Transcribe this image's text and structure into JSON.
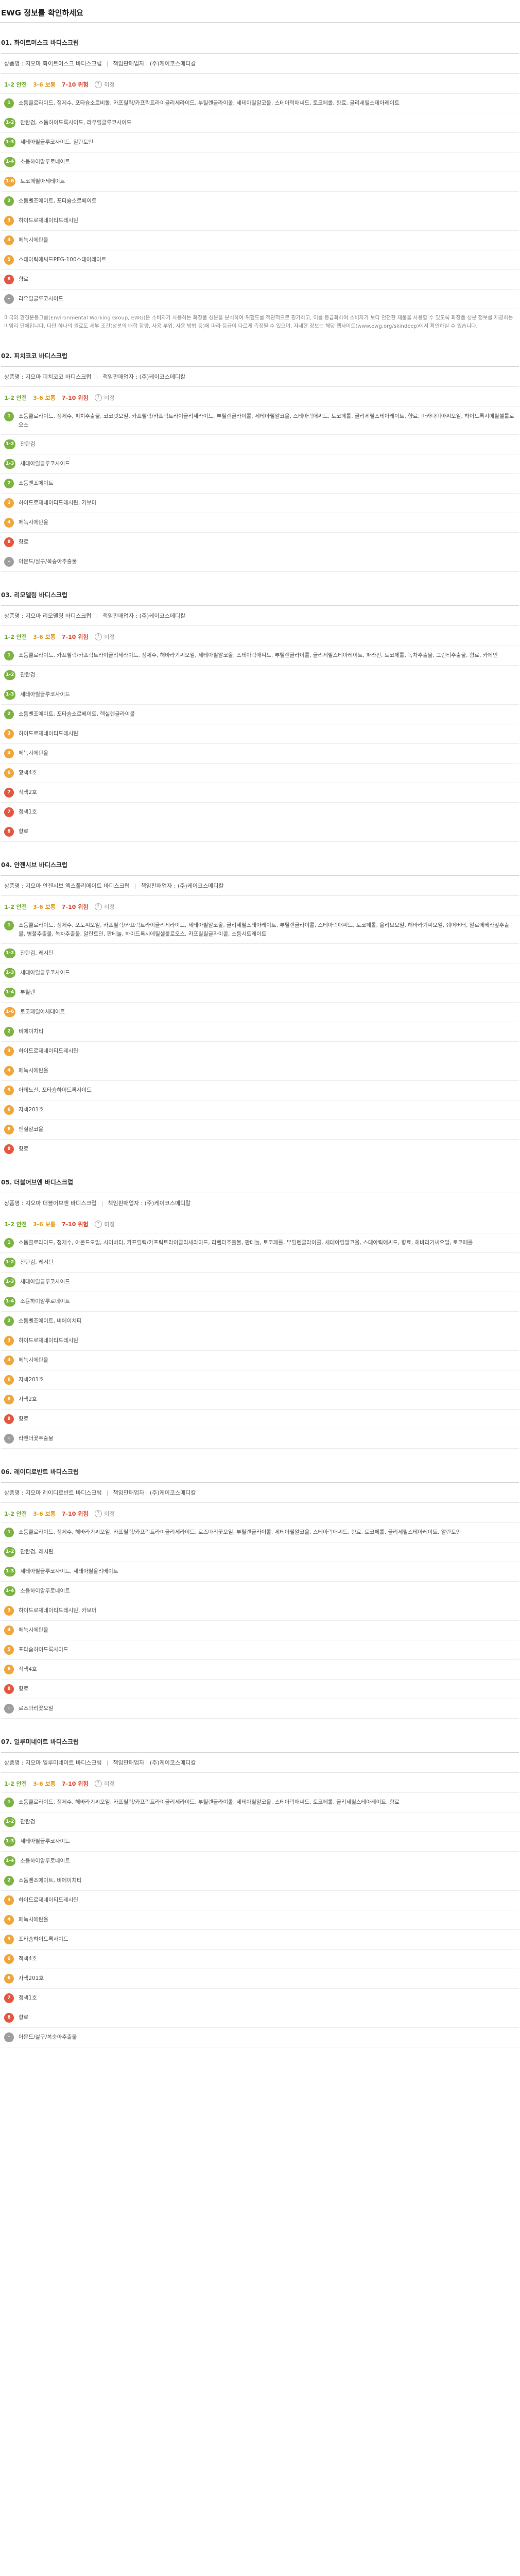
{
  "page": {
    "title": "EWG 정보를 확인하세요"
  },
  "legend": {
    "low": "1-2 안전",
    "mid": "3-6 보통",
    "high": "7-10 위험",
    "na": "미정"
  },
  "labels": {
    "product_prefix": "상품명 : ",
    "maker_prefix": "책임판매업자 : "
  },
  "notice": "미국의 환경운동그룹(Environmental Working Group, EWG)은 소비자가 사용하는 화장품 성분을 분석하여 위험도를 객관적으로 평가하고, 이를 등급화하여 소비자가 보다 안전한 제품을 사용할 수 있도록 화장품 성분 정보를 제공하는 비영리 단체입니다. 다만 하나의 원료도 세부 조건(성분의 배합 함량, 사용 부위, 사용 방법 등)에 따라 등급이 다르게 측정될 수 있으며, 자세한 정보는 해당 웹사이트(www.ewg.org/skindeep)에서 확인하실 수 있습니다.",
  "products": [
    {
      "section_title": "01. 화이트머스크 바디스크럽",
      "product_name": "지오마 화이트머스크 바디스크럽",
      "maker": "(주)케이코스메디칼",
      "ingredients": [
        {
          "grade": "1",
          "level": "low",
          "names": "소듐클로라이드, 정제수, 포타슘소르비톨, 카프릴릭/카프릭트라이글리세라이드, 부틸렌글라이콜, 세테아릴알코올, 스테아릭애씨드, 토코페롤, 향료, 글리세릴스테아레이트"
        },
        {
          "grade": "1-2",
          "level": "low",
          "names": "잔탄검, 소듐하이드록사이드, 라우릴글루코사이드"
        },
        {
          "grade": "1-3",
          "level": "low",
          "names": "세테아릴글루코사이드, 알란토인"
        },
        {
          "grade": "1-4",
          "level": "low",
          "names": "소듐하이알루로네이트"
        },
        {
          "grade": "1-6",
          "level": "mid",
          "names": "토코페릴아세테이트"
        },
        {
          "grade": "2",
          "level": "low",
          "names": "소듐벤조에이트, 포타슘소르베이트"
        },
        {
          "grade": "3",
          "level": "mid",
          "names": "하이드로제네이티드레시틴"
        },
        {
          "grade": "4",
          "level": "mid",
          "names": "페녹시에탄올"
        },
        {
          "grade": "5",
          "level": "mid",
          "names": "스테아릭애씨드PEG-100스테아레이트"
        },
        {
          "grade": "8",
          "level": "high",
          "names": "향료"
        },
        {
          "grade": "-",
          "level": "na",
          "names": "라우릴글루코사이드"
        }
      ]
    },
    {
      "section_title": "02. 피치코코 바디스크럽",
      "product_name": "지오마 피치코코 바디스크럽",
      "maker": "(주)케이코스메디칼",
      "ingredients": [
        {
          "grade": "1",
          "level": "low",
          "names": "소듐클로라이드, 정제수, 피치추출물, 코코넛오일, 카프릴릭/카프릭트라이글리세라이드, 부틸렌글라이콜, 세테아릴알코올, 스테아릭애씨드, 토코페롤, 글리세릴스테아레이트, 향료, 마카다미아씨오일, 하이드록시에틸셀룰로오스"
        },
        {
          "grade": "1-2",
          "level": "low",
          "names": "잔탄검"
        },
        {
          "grade": "1-3",
          "level": "low",
          "names": "세테아릴글루코사이드"
        },
        {
          "grade": "2",
          "level": "low",
          "names": "소듐벤조에이트"
        },
        {
          "grade": "3",
          "level": "mid",
          "names": "하이드로제네이티드레시틴, 카보머"
        },
        {
          "grade": "4",
          "level": "mid",
          "names": "페녹시에탄올"
        },
        {
          "grade": "8",
          "level": "high",
          "names": "향료"
        },
        {
          "grade": "-",
          "level": "na",
          "names": "아몬드/살구/복숭아추출물"
        }
      ]
    },
    {
      "section_title": "03. 리모델링 바디스크럽",
      "product_name": "지오마 리모델링 바디스크럽",
      "maker": "(주)케이코스메디칼",
      "ingredients": [
        {
          "grade": "1",
          "level": "low",
          "names": "소듐클로라이드, 카프릴릭/카프릭트라이글리세라이드, 정제수, 해바라기씨오일, 세테아릴알코올, 스테아릭애씨드, 부틸렌글라이콜, 글리세릴스테아레이트, 파라핀, 토코페롤, 녹차추출물, 그린티추출물, 향료, 카페인"
        },
        {
          "grade": "1-2",
          "level": "low",
          "names": "잔탄검"
        },
        {
          "grade": "1-3",
          "level": "low",
          "names": "세테아릴글루코사이드"
        },
        {
          "grade": "2",
          "level": "low",
          "names": "소듐벤조에이트, 포타슘소르베이트, 헥실렌글라이콜"
        },
        {
          "grade": "3",
          "level": "mid",
          "names": "하이드로제네이티드레시틴"
        },
        {
          "grade": "4",
          "level": "mid",
          "names": "페녹시에탄올"
        },
        {
          "grade": "6",
          "level": "mid",
          "names": "황색4호"
        },
        {
          "grade": "7",
          "level": "high",
          "names": "적색2호"
        },
        {
          "grade": "7",
          "level": "high",
          "names": "청색1호"
        },
        {
          "grade": "8",
          "level": "high",
          "names": "향료"
        }
      ]
    },
    {
      "section_title": "04. 안젠시브 바디스크럽",
      "product_name": "지오마 안젠시브 엑스폴리에이트 바디스크럽",
      "maker": "(주)케이코스메디칼",
      "ingredients": [
        {
          "grade": "1",
          "level": "low",
          "names": "소듐클로라이드, 정제수, 포도씨오일, 카프릴릭/카프릭트라이글리세라이드, 세테아릴알코올, 글리세릴스테아레이트, 부틸렌글라이콜, 스테아릭애씨드, 토코페롤, 올리브오일, 해바라기씨오일, 쉐어버터, 알로에베라잎추출물, 병풀추출물, 녹차추출물, 알란토인, 판테놀, 하이드록시에틸셀룰로오스, 카프릴릴글라이콜, 소듐시트레이트"
        },
        {
          "grade": "1-2",
          "level": "low",
          "names": "잔탄검, 레시틴"
        },
        {
          "grade": "1-3",
          "level": "low",
          "names": "세테아릴글루코사이드"
        },
        {
          "grade": "1-4",
          "level": "low",
          "names": "부틸렌"
        },
        {
          "grade": "1-6",
          "level": "mid",
          "names": "토코페릴아세테이트"
        },
        {
          "grade": "2",
          "level": "low",
          "names": "비에이치티"
        },
        {
          "grade": "3",
          "level": "mid",
          "names": "하이드로제네이티드레시틴"
        },
        {
          "grade": "4",
          "level": "mid",
          "names": "페녹시에탄올"
        },
        {
          "grade": "5",
          "level": "mid",
          "names": "아데노신, 포타슘하이드록사이드"
        },
        {
          "grade": "6",
          "level": "mid",
          "names": "자색201호"
        },
        {
          "grade": "6",
          "level": "mid",
          "names": "벤질알코올"
        },
        {
          "grade": "8",
          "level": "high",
          "names": "향료"
        }
      ]
    },
    {
      "section_title": "05. 더블어브앤 바디스크럽",
      "product_name": "지오마 더블어브앤 바디스크럽",
      "maker": "(주)케이코스메디칼",
      "ingredients": [
        {
          "grade": "1",
          "level": "low",
          "names": "소듐클로라이드, 정제수, 아몬드오일, 시어버터, 카프릴릭/카프릭트라이글리세라이드, 라벤더추출물, 판테놀, 토코페롤, 부틸렌글라이콜, 세테아릴알코올, 스테아릭애씨드, 향료, 해바라기씨오일, 토코페롤"
        },
        {
          "grade": "1-2",
          "level": "low",
          "names": "잔탄검, 레시틴"
        },
        {
          "grade": "1-3",
          "level": "low",
          "names": "세테아릴글루코사이드"
        },
        {
          "grade": "1-4",
          "level": "low",
          "names": "소듐하이알루로네이트"
        },
        {
          "grade": "2",
          "level": "low",
          "names": "소듐벤조에이트, 비에이치티"
        },
        {
          "grade": "3",
          "level": "mid",
          "names": "하이드로제네이티드레시틴"
        },
        {
          "grade": "4",
          "level": "mid",
          "names": "페녹시에탄올"
        },
        {
          "grade": "6",
          "level": "mid",
          "names": "자색201호"
        },
        {
          "grade": "6",
          "level": "mid",
          "names": "자색2호"
        },
        {
          "grade": "8",
          "level": "high",
          "names": "향료"
        },
        {
          "grade": "-",
          "level": "na",
          "names": "라벤더꽃추출물"
        }
      ]
    },
    {
      "section_title": "06. 레이디로반트 바디스크럽",
      "product_name": "지오마 레이디로반트 바디스크럽",
      "maker": "(주)케이코스메디칼",
      "ingredients": [
        {
          "grade": "1",
          "level": "low",
          "names": "소듐클로라이드, 정제수, 해바라기씨오일, 카프릴릭/카프릭트라이글리세라이드, 로즈마리꽃오일, 부틸렌글라이콜, 세테아릴알코올, 스테아릭애씨드, 향료, 토코페롤, 글리세릴스테아레이트, 알란토인"
        },
        {
          "grade": "1-2",
          "level": "low",
          "names": "잔탄검, 레시틴"
        },
        {
          "grade": "1-3",
          "level": "low",
          "names": "세테아릴글루코사이드, 세테아릴올리베이트"
        },
        {
          "grade": "1-4",
          "level": "low",
          "names": "소듐하이알루로네이트"
        },
        {
          "grade": "3",
          "level": "mid",
          "names": "하이드로제네이티드레시틴, 카보머"
        },
        {
          "grade": "4",
          "level": "mid",
          "names": "페녹시에탄올"
        },
        {
          "grade": "5",
          "level": "mid",
          "names": "포타슘하이드록사이드"
        },
        {
          "grade": "6",
          "level": "mid",
          "names": "적색4호"
        },
        {
          "grade": "8",
          "level": "high",
          "names": "향료"
        },
        {
          "grade": "-",
          "level": "na",
          "names": "로즈마리꽃오일"
        }
      ]
    },
    {
      "section_title": "07. 일루미네이트 바디스크럽",
      "product_name": "지오마 일루미네이트 바디스크럽",
      "maker": "(주)케이코스메디칼",
      "ingredients": [
        {
          "grade": "1",
          "level": "low",
          "names": "소듐클로라이드, 정제수, 해바라기씨오일, 카프릴릭/카프릭트라이글리세라이드, 부틸렌글라이콜, 세테아릴알코올, 스테아릭애씨드, 토코페롤, 글리세릴스테아레이트, 향료"
        },
        {
          "grade": "1-2",
          "level": "low",
          "names": "잔탄검"
        },
        {
          "grade": "1-3",
          "level": "low",
          "names": "세테아릴글루코사이드"
        },
        {
          "grade": "1-4",
          "level": "low",
          "names": "소듐하이알루로네이트"
        },
        {
          "grade": "2",
          "level": "low",
          "names": "소듐벤조에이트, 비에이치티"
        },
        {
          "grade": "3",
          "level": "mid",
          "names": "하이드로제네이티드레시틴"
        },
        {
          "grade": "4",
          "level": "mid",
          "names": "페녹시에탄올"
        },
        {
          "grade": "5",
          "level": "mid",
          "names": "포타슘하이드록사이드"
        },
        {
          "grade": "6",
          "level": "mid",
          "names": "적색4호"
        },
        {
          "grade": "6",
          "level": "mid",
          "names": "자색201호"
        },
        {
          "grade": "7",
          "level": "high",
          "names": "청색1호"
        },
        {
          "grade": "8",
          "level": "high",
          "names": "향료"
        },
        {
          "grade": "-",
          "level": "na",
          "names": "아몬드/살구/복숭아추출물"
        }
      ]
    }
  ]
}
